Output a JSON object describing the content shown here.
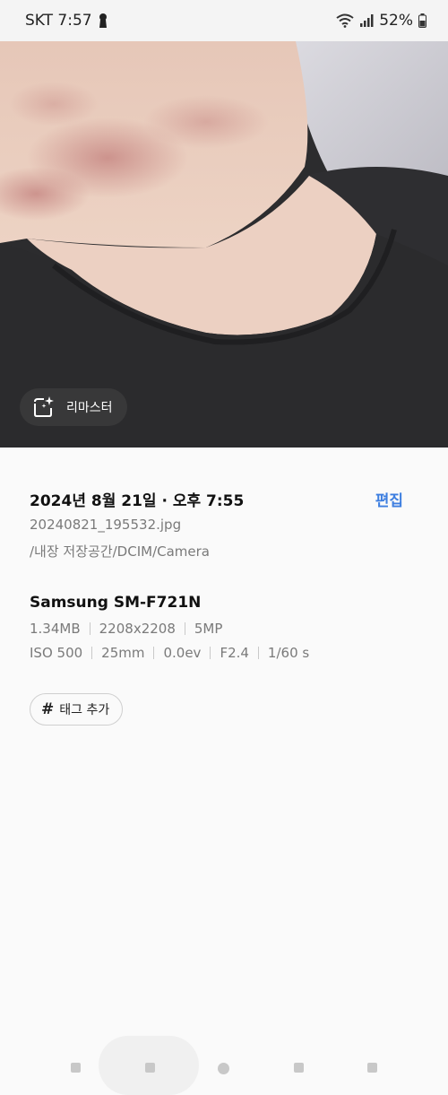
{
  "status_bar": {
    "carrier_time": "SKT 7:57",
    "battery_percent": "52%",
    "icons": [
      "lock-icon",
      "wifi-icon",
      "signal-icon",
      "battery-icon"
    ]
  },
  "photo": {
    "remaster_label": "리마스터"
  },
  "details": {
    "date_time": "2024년 8월 21일 · 오후 7:55",
    "edit_label": "편집",
    "filename": "20240821_195532.jpg",
    "path": "/내장 저장공간/DCIM/Camera",
    "device": "Samsung SM-F721N",
    "file_specs": [
      "1.34MB",
      "2208x2208",
      "5MP"
    ],
    "camera_specs": [
      "ISO 500",
      "25mm",
      "0.0ev",
      "F2.4",
      "1/60 s"
    ]
  },
  "tag_button": {
    "hash": "#",
    "label": "태그 추가"
  },
  "colors": {
    "accent": "#3e7fe0",
    "secondary_text": "#7a7a7a",
    "background": "#fafafa"
  }
}
